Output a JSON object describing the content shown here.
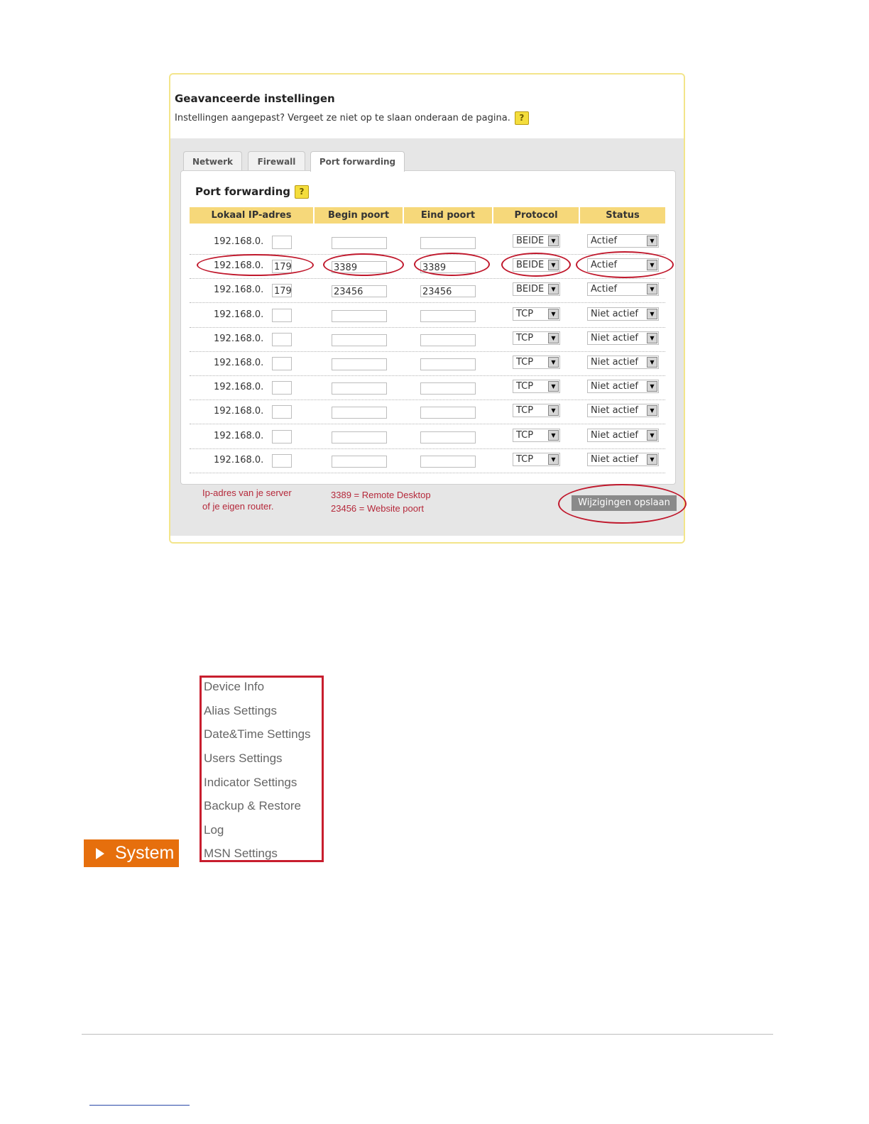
{
  "router": {
    "title": "Geavanceerde instellingen",
    "subtitle": "Instellingen aangepast? Vergeet ze niet op te slaan onderaan de pagina.",
    "help_glyph": "?",
    "tabs": [
      "Netwerk",
      "Firewall",
      "Port forwarding"
    ],
    "active_tab": "Port forwarding",
    "section_title": "Port forwarding",
    "columns": [
      "Lokaal IP-adres",
      "Begin poort",
      "Eind poort",
      "Protocol",
      "Status"
    ],
    "ip_prefix": "192.168.0.",
    "rows": [
      {
        "ip": "",
        "begin": "",
        "end": "",
        "protocol": "BEIDE",
        "status": "Actief"
      },
      {
        "ip": "179",
        "begin": "3389",
        "end": "3389",
        "protocol": "BEIDE",
        "status": "Actief"
      },
      {
        "ip": "179",
        "begin": "23456",
        "end": "23456",
        "protocol": "BEIDE",
        "status": "Actief"
      },
      {
        "ip": "",
        "begin": "",
        "end": "",
        "protocol": "TCP",
        "status": "Niet actief"
      },
      {
        "ip": "",
        "begin": "",
        "end": "",
        "protocol": "TCP",
        "status": "Niet actief"
      },
      {
        "ip": "",
        "begin": "",
        "end": "",
        "protocol": "TCP",
        "status": "Niet actief"
      },
      {
        "ip": "",
        "begin": "",
        "end": "",
        "protocol": "TCP",
        "status": "Niet actief"
      },
      {
        "ip": "",
        "begin": "",
        "end": "",
        "protocol": "TCP",
        "status": "Niet actief"
      },
      {
        "ip": "",
        "begin": "",
        "end": "",
        "protocol": "TCP",
        "status": "Niet actief"
      },
      {
        "ip": "",
        "begin": "",
        "end": "",
        "protocol": "TCP",
        "status": "Niet actief"
      }
    ],
    "note_ip": [
      "Ip-adres van je server",
      "of je eigen router."
    ],
    "note_ports": [
      "3389 = Remote Desktop",
      "23456 = Website poort"
    ],
    "save_label": "Wijzigingen opslaan",
    "annotation_color": "#c0182c"
  },
  "system_menu": {
    "button_label": "System",
    "button_color": "#e66f0d",
    "items": [
      "Device Info",
      "Alias Settings",
      "Date&Time Settings",
      "Users Settings",
      "Indicator Settings",
      "Backup & Restore",
      "Log",
      "MSN Settings"
    ]
  }
}
